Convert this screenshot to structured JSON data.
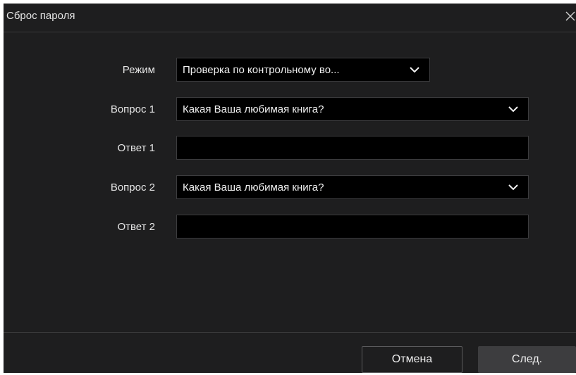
{
  "dialog": {
    "title": "Сброс пароля"
  },
  "form": {
    "mode": {
      "label": "Режим",
      "value": "Проверка по контрольному во..."
    },
    "question1": {
      "label": "Вопрос 1",
      "value": "Какая Ваша любимая книга?"
    },
    "answer1": {
      "label": "Ответ 1",
      "value": ""
    },
    "question2": {
      "label": "Вопрос 2",
      "value": "Какая Ваша любимая книга?"
    },
    "answer2": {
      "label": "Ответ 2",
      "value": ""
    }
  },
  "footer": {
    "cancel_label": "Отмена",
    "next_label": "След."
  },
  "colors": {
    "background": "#1e1e1f",
    "field_background": "#000000",
    "text": "#e6e6e6"
  },
  "icons": {
    "close": "close-icon",
    "dropdown": "chevron-down-icon"
  }
}
